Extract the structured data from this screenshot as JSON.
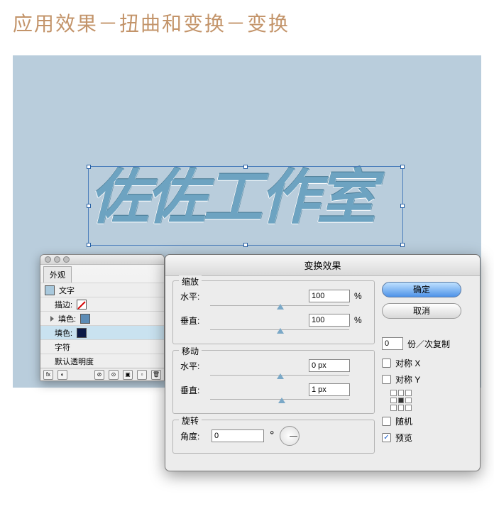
{
  "page_title": "应用效果－扭曲和变换－变换",
  "artwork_text": "佐佐工作室",
  "appearance": {
    "tab": "外观",
    "rows": {
      "text": "文字",
      "stroke": "描边:",
      "fill": "填色:",
      "char": "字符",
      "opacity": "默认透明度"
    }
  },
  "dialog": {
    "title": "变换效果",
    "scale": {
      "legend": "缩放",
      "h_label": "水平:",
      "v_label": "垂直:",
      "h_value": "100",
      "v_value": "100",
      "unit": "%"
    },
    "move": {
      "legend": "移动",
      "h_label": "水平:",
      "v_label": "垂直:",
      "h_value": "0 px",
      "v_value": "1 px"
    },
    "rotate": {
      "legend": "旋转",
      "label": "角度:",
      "value": "0",
      "unit": "°"
    },
    "ok": "确定",
    "cancel": "取消",
    "copies_value": "0",
    "copies_label": "份／次复制",
    "reflect_x": "对称 X",
    "reflect_y": "对称 Y",
    "random": "随机",
    "preview": "预览"
  }
}
